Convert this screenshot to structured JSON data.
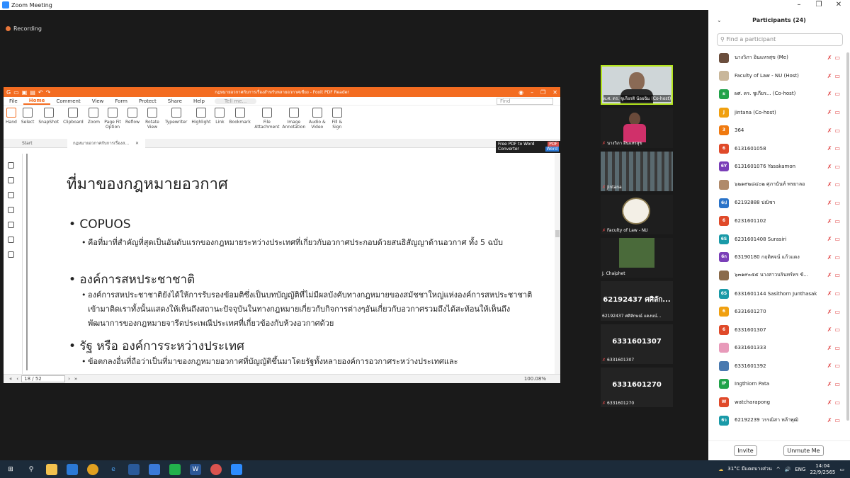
{
  "window": {
    "title": "Zoom Meeting",
    "minimize": "–",
    "restore": "❐",
    "close": "✕"
  },
  "recording": "Recording",
  "foxit": {
    "title": "กฎหมายอวกาศกับการเรื่องสำหรับหลายอวกาศเชียง - Foxit PDF Reader",
    "menu": [
      "File",
      "Home",
      "Comment",
      "View",
      "Form",
      "Protect",
      "Share",
      "Help"
    ],
    "tell_me": "Tell me...",
    "find": "Find",
    "ribbon": [
      "Hand",
      "Select",
      "SnapShot",
      "Clipboard",
      "Zoom",
      "Page Fit Option",
      "Reflow",
      "Rotate View",
      "Typewriter",
      "Highlight",
      "Link",
      "Bookmark",
      "File Attachment",
      "Image Annotation",
      "Audio & Video",
      "Fill & Sign"
    ],
    "tab_start": "Start",
    "tab_doc": "กฎหมายอวกาศกับการเรื่องส...",
    "freepdf_line1": "Free PDF to Word",
    "freepdf_line2": "Converter",
    "pdf_badge": "PDF",
    "word_badge": "Word",
    "doc": {
      "heading": "ที่มาของกฎหมายอวกาศ",
      "b1": "• COPUOS",
      "b1_sub": "คือที่มาที่สำคัญที่สุดเป็นอันดับแรกของกฎหมายระหว่างประเทศที่เกี่ยวกับอวกาศประกอบด้วยสนธิสัญญาด้านอวกาศ ทั้ง 5 ฉบับ",
      "b2": "• องค์การสหประชาชาติ",
      "b2_sub": "องค์การสหประชาชาติยังได้ให้การรับรองข้อมติซึ่งเป็นบทบัญญัติที่ไม่มีผลบังคับทางกฎหมายของสมัชชาใหญ่แห่งองค์การสหประชาชาติเข้ามาติดเราทั้งนั้นแสดงให้เห็นถึงสถานะปัจจุบันในทางกฎหมายเกี่ยวกับกิจการต่างๆอันเกี่ยวกับอวกาศรวมถึงได้สะท้อนให้เห็นถึงพัฒนาการของกฎหมายจารีตประเพณีประเทศที่เกี่ยวข้องกับห้วงอวกาศด้วย",
      "b3": "• รัฐ หรือ องค์การระหว่างประเทศ",
      "b3_sub": "ข้อตกลงอื่นที่ถือว่าเป็นที่มาของกฎหมายอวกาศที่บัญญัติขึ้นมาโดยรัฐทั้งหลายองค์การอวกาศระหว่างประเทศและ"
    },
    "page": "18 / 52",
    "zoom": "100.08%"
  },
  "thumbs": [
    {
      "name": "ผ.ศ. ดร. ชูเกียรติ น้อยฉิม (Co-host)",
      "big": ""
    },
    {
      "name": "นางวิภา อินแหรสุข",
      "big": ""
    },
    {
      "name": "jintana",
      "big": ""
    },
    {
      "name": "Faculty of Law - NU",
      "big": ""
    },
    {
      "name": "J. Chaiphet",
      "big": ""
    },
    {
      "name": "62192437 ศศิลักษณ์ แดงนน์...",
      "big": "62192437 ศศิลัก..."
    },
    {
      "name": "6331601307",
      "big": "6331601307"
    },
    {
      "name": "6331601270",
      "big": "6331601270"
    }
  ],
  "participants": {
    "title": "Participants (24)",
    "search_placeholder": "Find a participant",
    "list": [
      {
        "initial": "",
        "name": "นางวิภา อินแหรสุข (Me)",
        "color": "#6b4e3d"
      },
      {
        "initial": "",
        "name": "Faculty of Law - NU (Host)",
        "color": "#c9b79a"
      },
      {
        "initial": "ผ",
        "name": "ผศ. ดร. ชูเกียร... (Co-host)",
        "color": "#22a34a"
      },
      {
        "initial": "J",
        "name": "jintana (Co-host)",
        "color": "#f0a010"
      },
      {
        "initial": "3",
        "name": "364",
        "color": "#f07a10"
      },
      {
        "initial": "6",
        "name": "6131601058",
        "color": "#e04a2a"
      },
      {
        "initial": "6Y",
        "name": "6131601076 Yasakamon",
        "color": "#7a3fb8"
      },
      {
        "initial": "",
        "name": "๖๒๑๙๒๘๔๐๒ ศุภานันท์ พรยาลอ",
        "color": "#b08a6a"
      },
      {
        "initial": "6ป",
        "name": "62192888 ปณิชา",
        "color": "#2a73c9"
      },
      {
        "initial": "6",
        "name": "6231601102",
        "color": "#e04a2a"
      },
      {
        "initial": "6S",
        "name": "6231601408 Surasiri",
        "color": "#1a9aa8"
      },
      {
        "initial": "6ก",
        "name": "63190180 กฤติพจน์ แก้วแดง",
        "color": "#7a3fb8"
      },
      {
        "initial": "",
        "name": "๖๓๑๙๐๕๕ นางสาวนรินทร์ทร ข้...",
        "color": "#8a6a4a"
      },
      {
        "initial": "6S",
        "name": "6331601144 Sasithorn Junthasak",
        "color": "#1a9aa8"
      },
      {
        "initial": "6",
        "name": "6331601270",
        "color": "#f0a010"
      },
      {
        "initial": "6",
        "name": "6331601307",
        "color": "#e04a2a"
      },
      {
        "initial": "",
        "name": "6331601333",
        "color": "#e89aba"
      },
      {
        "initial": "",
        "name": "6331601392",
        "color": "#4a7ab0"
      },
      {
        "initial": "IP",
        "name": "Ingthiorn Pata",
        "color": "#22a34a"
      },
      {
        "initial": "W",
        "name": "watcharapong",
        "color": "#e04a2a"
      },
      {
        "initial": "6ว",
        "name": "62192239 วรรณิสา หล้าพุฒิ",
        "color": "#1a9aa8"
      }
    ],
    "invite": "Invite",
    "unmute": "Unmute Me"
  },
  "taskbar": {
    "weather": "31°C มีแดดบางส่วน",
    "lang": "ENG",
    "time": "14:04",
    "date": "22/9/2565"
  }
}
